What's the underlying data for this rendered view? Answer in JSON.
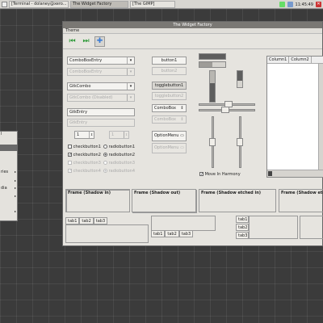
{
  "panel": {
    "tasks": [
      "[Terminal - dolaney@xero...",
      "The Widget Factory",
      "[The GIMP]"
    ],
    "clock": "11:45:49"
  },
  "menu": {
    "items": [
      {
        "label": "l",
        "arrow": ""
      },
      {
        "label": "",
        "arrow": "",
        "selected": true
      },
      {
        "label": "ries",
        "arrow": "▸"
      },
      {
        "label": "",
        "arrow": "▸"
      },
      {
        "label": "dia",
        "arrow": "▸"
      },
      {
        "label": "",
        "arrow": "▸"
      },
      {
        "label": "",
        "arrow": "▸"
      }
    ]
  },
  "window": {
    "title": "The Widget Factory",
    "menu_label": "Theme",
    "col1": {
      "combo_entry": "ComboBoxEntry",
      "combo_entry_dis": "ComboBoxEntry",
      "gtkcombo": "GtkCombo",
      "gtkcombo_dis": "GtkCombo (Disabled)",
      "entry": "GtkEntry",
      "entry_dis": "GtkEntry",
      "spin": "1",
      "spin_dis": "1",
      "check1": "checkbutton1",
      "check2": "checkbutton2",
      "check3": "checkbutton3",
      "check4": "checkbutton4",
      "radio1": "radiobutton1",
      "radio2": "radiobutton2",
      "radio3": "radiobutton3",
      "radio4": "radiobutton4"
    },
    "col2": {
      "button1": "button1",
      "button2": "button2",
      "toggle1": "togglebutton1",
      "toggle2": "togglebutton2",
      "combobox": "ComboBox",
      "combobox_dis": "ComboBox",
      "optionmenu": "OptionMenu",
      "optionmenu_dis": "OptionMenu"
    },
    "move_harmony": "Move In Harmony",
    "list": {
      "col1": "Column1",
      "col2": "Column2"
    },
    "frames": [
      "Frame (Shadow in)",
      "Frame (Shadow out)",
      "Frame (Shadow etched in)",
      "Frame (Shadow etched ou"
    ],
    "tabs": [
      "tab1",
      "tab2",
      "tab3"
    ]
  }
}
